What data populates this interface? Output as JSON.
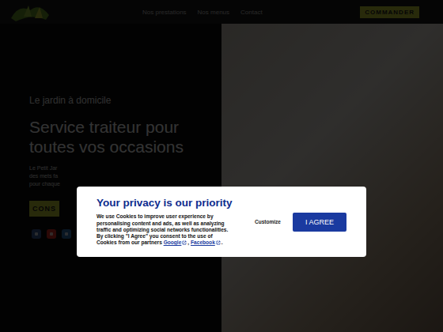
{
  "header": {
    "nav": [
      "Nos prestations",
      "Nos menus",
      "Contact"
    ],
    "cta": "COMMANDER"
  },
  "hero": {
    "tagline": "Le jardin à domicile",
    "title": "Service traiteur pour toutes vos occasions",
    "paragraph": [
      "Le Petit Jar",
      "des mets fa",
      "pour chaque"
    ],
    "button": "CONS",
    "social": [
      {
        "color": "#3b5998"
      },
      {
        "color": "#d93025"
      },
      {
        "color": "#2f6fb0"
      }
    ]
  },
  "cookie_banner": {
    "title": "Your privacy is our priority",
    "text": "We use Cookies to improve user experience by personalising content and ads, as well as analyzing traffic and optimizing social networks functionalities. By clicking \"I Agree\" you consent to the use of Cookies from our partners ",
    "links": [
      "Google",
      "Facebook"
    ],
    "separator": ", ",
    "end": ".",
    "customize": "Customize",
    "agree": "I AGREE"
  }
}
